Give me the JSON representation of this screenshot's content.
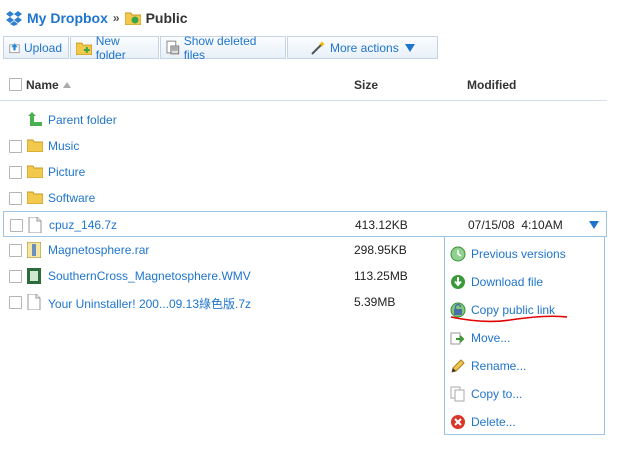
{
  "breadcrumb": {
    "root": "My Dropbox",
    "separator": "»",
    "current": "Public"
  },
  "toolbar": {
    "upload": "Upload",
    "new_folder": "New folder",
    "show_deleted": "Show deleted files",
    "more_actions": "More actions"
  },
  "columns": {
    "name": "Name",
    "size": "Size",
    "modified": "Modified"
  },
  "parent": "Parent folder",
  "folders": [
    "Music",
    "Picture",
    "Software"
  ],
  "files": [
    {
      "name": "cpuz_146.7z",
      "size": "413.12KB",
      "modified": "07/15/08  4:10AM"
    },
    {
      "name": "Magnetosphere.rar",
      "size": "298.95KB",
      "modified": ""
    },
    {
      "name": "SouthernCross_Magnetosphere.WMV",
      "size": "113.25MB",
      "modified": ""
    },
    {
      "name": "Your Uninstaller! 200...09.13綠色版.7z",
      "size": "5.39MB",
      "modified": ""
    }
  ],
  "menu": {
    "previous_versions": "Previous versions",
    "download": "Download file",
    "copy_link": "Copy public link",
    "move": "Move...",
    "rename": "Rename...",
    "copy_to": "Copy to...",
    "delete": "Delete..."
  },
  "colors": {
    "link": "#1f75cc",
    "annotation": "#e00000"
  }
}
